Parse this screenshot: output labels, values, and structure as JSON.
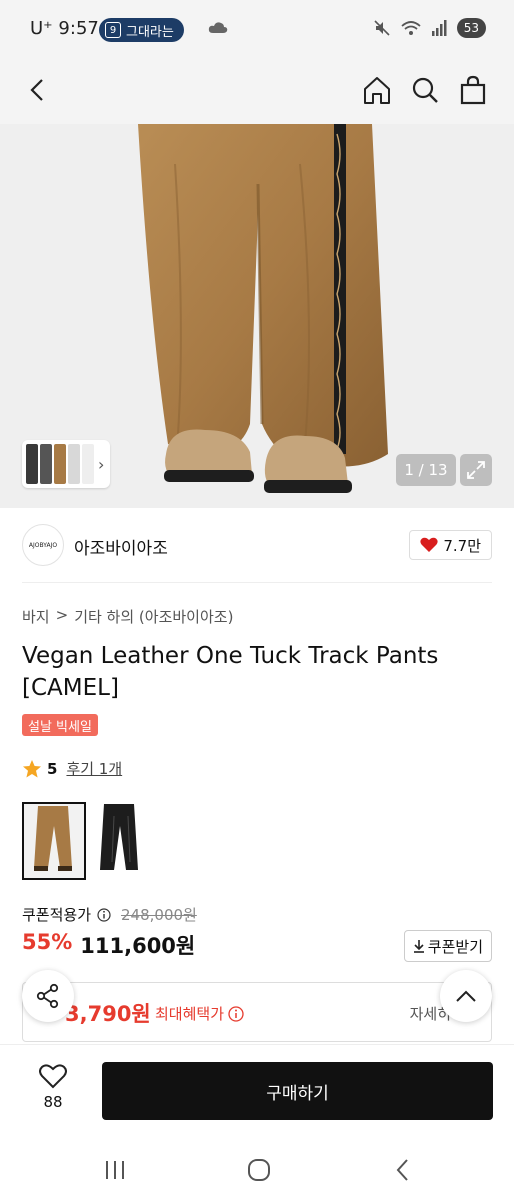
{
  "status_bar": {
    "carrier": "U⁺",
    "time": "9:57",
    "notification_badge": "9",
    "notification_text": "그대라는",
    "battery": "53",
    "icons": [
      "cloud-icon",
      "mute-icon",
      "wifi-icon",
      "signal-icon",
      "battery-icon"
    ]
  },
  "top_nav": {
    "icons": [
      "back-icon",
      "home-icon",
      "search-icon",
      "bag-icon"
    ]
  },
  "gallery": {
    "counter": "1 / 13",
    "thumb_arrow": "›"
  },
  "brand": {
    "logo_text": "AJOBYAJO",
    "name": "아조바이아조",
    "likes": "7.7만"
  },
  "product": {
    "breadcrumb": [
      "바지",
      ">",
      "기타 하의 (아조바이아조)"
    ],
    "title": "Vegan Leather One Tuck Track Pants [CAMEL]",
    "sale_badge": "설날 빅세일",
    "rating": "5",
    "reviews": "후기 1개",
    "price_label": "쿠폰적용가",
    "original_price": "248,000원",
    "discount": "55%",
    "price": "111,600원",
    "coupon_button": "쿠폰받기",
    "benefit_price": "3,790원",
    "benefit_label": "최대혜택가",
    "benefit_detail": "자세히"
  },
  "bottom_bar": {
    "wish_count": "88",
    "buy_label": "구매하기"
  },
  "colors": {
    "accent_red": "#e63b2e",
    "badge": "#f26b5c",
    "buy": "#111111",
    "camel": "#a77a45"
  }
}
